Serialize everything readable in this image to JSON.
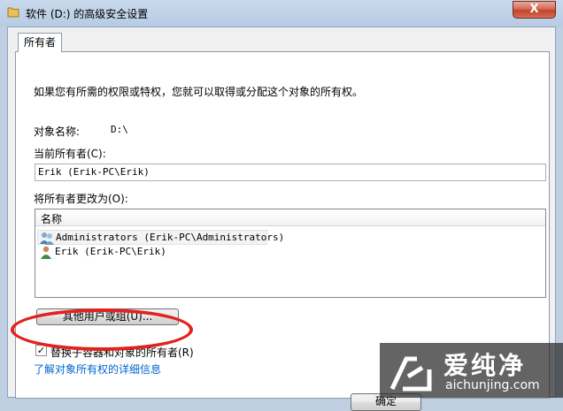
{
  "window": {
    "title": "软件 (D:) 的高级安全设置",
    "close_label": "X"
  },
  "tab": {
    "label": "所有者"
  },
  "intro": "如果您有所需的权限或特权，您就可以取得或分配这个对象的所有权。",
  "object_name": {
    "label": "对象名称:",
    "value": "D:\\"
  },
  "current_owner": {
    "label": "当前所有者(C):",
    "value": "Erik (Erik-PC\\Erik)"
  },
  "change_owner": {
    "label": "将所有者更改为(O):",
    "column_header": "名称",
    "items": [
      {
        "name": "Administrators (Erik-PC\\Administrators)",
        "icon": "users-group-icon"
      },
      {
        "name": "Erik (Erik-PC\\Erik)",
        "icon": "user-icon"
      }
    ]
  },
  "other_users_button": "其他用户或组(U)...",
  "replace_checkbox": {
    "label": "替换子容器和对象的所有者(R)",
    "checked": true
  },
  "learn_more_link": "了解对象所有权的详细信息",
  "ok_button": "确定",
  "watermark": {
    "brand": "爱纯净",
    "url": "aichunjing.com"
  },
  "colors": {
    "highlight_circle": "#e0231f",
    "link": "#0066cc"
  }
}
